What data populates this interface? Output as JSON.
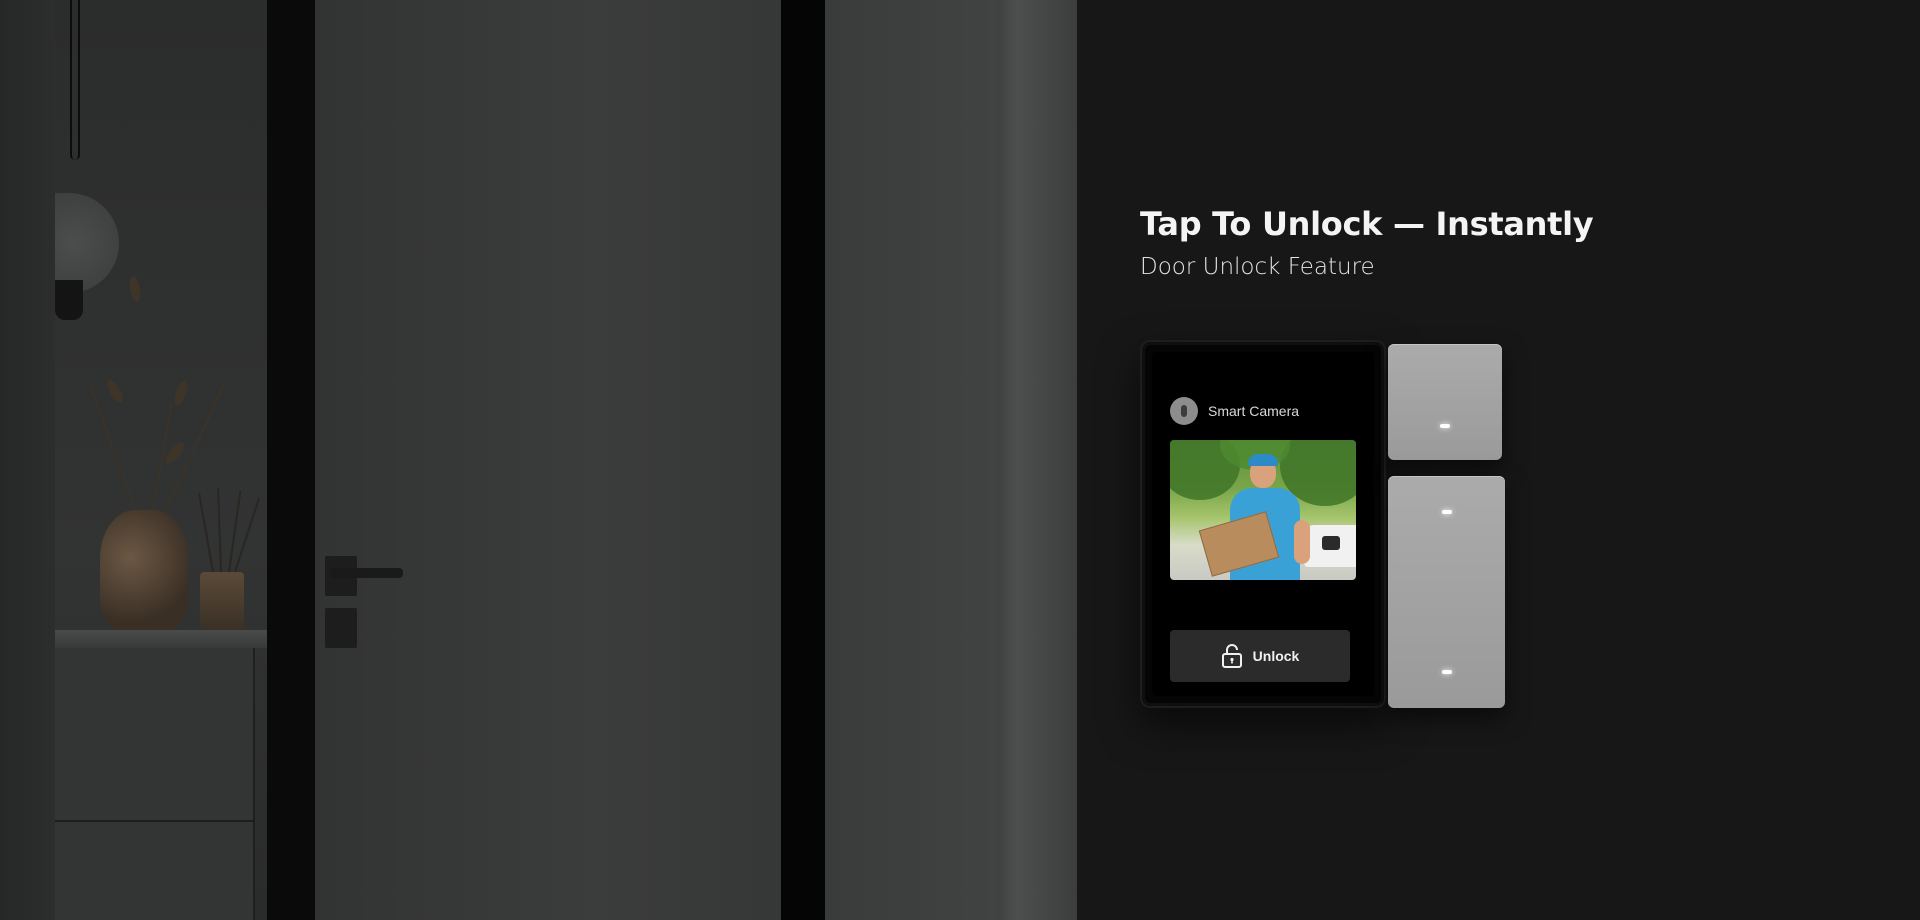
{
  "hero": {
    "title": "Tap To Unlock — Instantly",
    "subtitle": "Door Unlock Feature"
  },
  "device": {
    "camera_label": "Smart Camera",
    "unlock_label": "Unlock",
    "icons": {
      "camera": "camera-icon",
      "unlock": "unlocked-padlock-icon"
    }
  },
  "colors": {
    "page_background": "#171717",
    "title_text": "#f4f4f4",
    "button_background": "#2b2b2b",
    "switch_panel": "#a3a3a3",
    "led_indicator": "#ffffff"
  }
}
